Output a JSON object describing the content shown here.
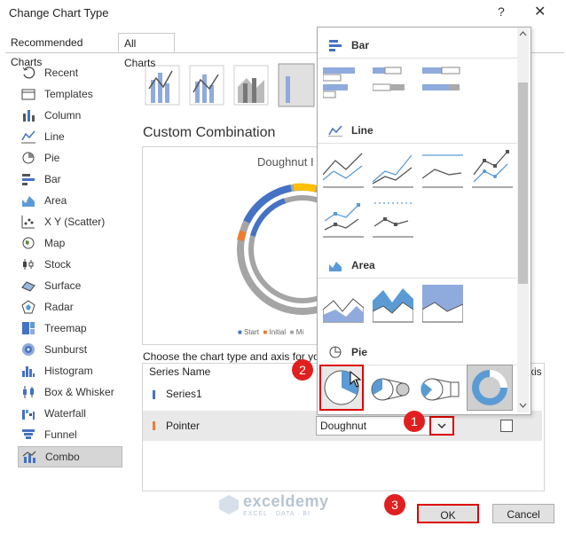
{
  "window": {
    "title": "Change Chart Type",
    "help": "?",
    "close": "✕"
  },
  "tabs": [
    {
      "label": "Recommended Charts"
    },
    {
      "label": "All Charts"
    }
  ],
  "sidebar": {
    "items": [
      {
        "label": "Recent",
        "icon": "recent-icon"
      },
      {
        "label": "Templates",
        "icon": "templates-icon"
      },
      {
        "label": "Column",
        "icon": "column-icon"
      },
      {
        "label": "Line",
        "icon": "line-icon"
      },
      {
        "label": "Pie",
        "icon": "pie-icon"
      },
      {
        "label": "Bar",
        "icon": "bar-icon"
      },
      {
        "label": "Area",
        "icon": "area-icon"
      },
      {
        "label": "X Y (Scatter)",
        "icon": "scatter-icon"
      },
      {
        "label": "Map",
        "icon": "map-icon"
      },
      {
        "label": "Stock",
        "icon": "stock-icon"
      },
      {
        "label": "Surface",
        "icon": "surface-icon"
      },
      {
        "label": "Radar",
        "icon": "radar-icon"
      },
      {
        "label": "Treemap",
        "icon": "treemap-icon"
      },
      {
        "label": "Sunburst",
        "icon": "sunburst-icon"
      },
      {
        "label": "Histogram",
        "icon": "histogram-icon"
      },
      {
        "label": "Box & Whisker",
        "icon": "box-whisker-icon"
      },
      {
        "label": "Waterfall",
        "icon": "waterfall-icon"
      },
      {
        "label": "Funnel",
        "icon": "funnel-icon"
      },
      {
        "label": "Combo",
        "icon": "combo-icon"
      }
    ],
    "selected": "Combo"
  },
  "main": {
    "heading": "Custom Combination",
    "chart_title": "Doughnut I",
    "legend": [
      "Start",
      "Initial",
      "Mi"
    ],
    "choose_label": "Choose the chart type and axis for you",
    "columns": {
      "series": "Series Name",
      "axis": "xis"
    },
    "rows": [
      {
        "name": "Series1",
        "color": "#4472c4"
      },
      {
        "name": "Pointer",
        "color": "#ed7d31",
        "chart_type": "Doughnut"
      }
    ]
  },
  "popup": {
    "sections": [
      {
        "label": "Bar"
      },
      {
        "label": "Line"
      },
      {
        "label": "Area"
      },
      {
        "label": "Pie"
      }
    ]
  },
  "badges": [
    "1",
    "2",
    "3"
  ],
  "buttons": {
    "ok": "OK",
    "cancel": "Cancel"
  },
  "watermark": {
    "name": "exceldemy",
    "sub": "EXCEL · DATA · BI"
  },
  "colors": {
    "accent": "#4472c4",
    "orange": "#ed7d31",
    "yellow": "#ffc000",
    "gray": "#a5a5a5",
    "highlight": "#e02020"
  }
}
